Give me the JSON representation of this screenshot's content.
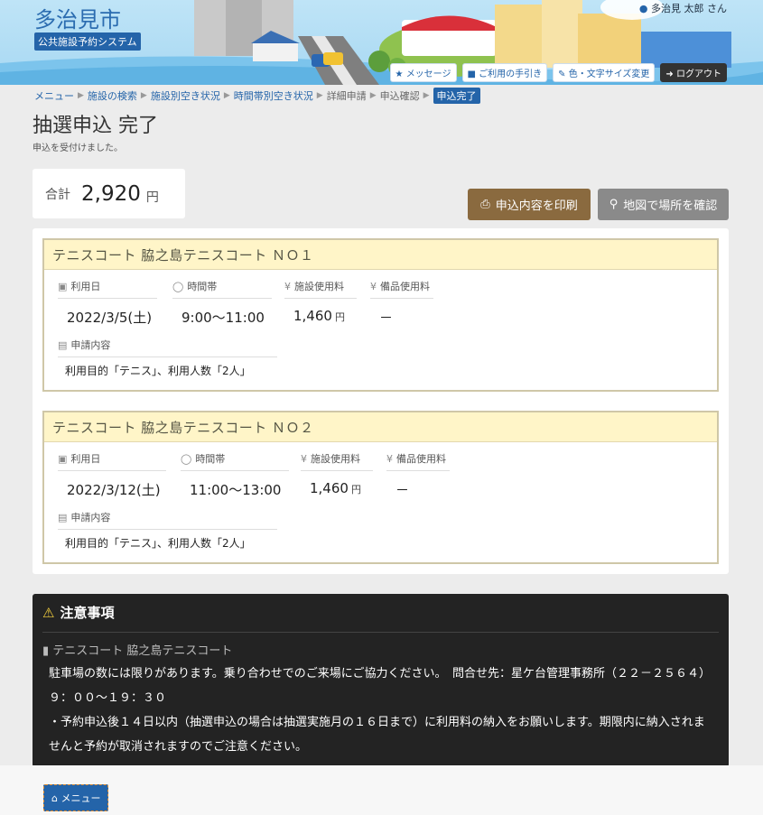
{
  "header": {
    "city": "多治見市",
    "system": "公共施設予約システム",
    "user": "多治見 太郎 さん",
    "buttons": {
      "message": "メッセージ",
      "guide": "ご利用の手引き",
      "display": "色・文字サイズ変更",
      "logout": "ログアウト"
    }
  },
  "breadcrumb": {
    "menu": "メニュー",
    "search": "施設の検索",
    "facility_vacancy": "施設別空き状況",
    "time_vacancy": "時間帯別空き状況",
    "detail": "詳細申請",
    "confirm": "申込確認",
    "current": "申込完了"
  },
  "page": {
    "title": "抽選申込 完了",
    "note": "申込を受付けました。"
  },
  "total": {
    "label": "合計",
    "value": "2,920",
    "unit": "円"
  },
  "actions": {
    "print": "申込内容を印刷",
    "map": "地図で場所を確認"
  },
  "labels": {
    "date": "利用日",
    "time": "時間帯",
    "facility_fee": "施設使用料",
    "equipment_fee": "備品使用料",
    "content": "申請内容",
    "yen": "円"
  },
  "reservations": [
    {
      "title": "テニスコート 脇之島テニスコート ＮＯ１",
      "date": "2022/3/5(土)",
      "time": "9:00～11:00",
      "facility_fee": "1,460",
      "equipment_fee": "－",
      "content": "利用目的「テニス」、利用人数「2人」"
    },
    {
      "title": "テニスコート 脇之島テニスコート ＮＯ２",
      "date": "2022/3/12(土)",
      "time": "11:00～13:00",
      "facility_fee": "1,460",
      "equipment_fee": "－",
      "content": "利用目的「テニス」、利用人数「2人」"
    }
  ],
  "notice": {
    "title": "注意事項",
    "facility": "テニスコート 脇之島テニスコート",
    "line1": "駐車場の数には限りがあります。乗り合わせでのご来場にご協力ください。　問合せ先：星ケ台管理事務所（２２－２５６４）　９：００～１９：３０",
    "line2": "・予約申込後１４日以内（抽選申込の場合は抽選実施月の１６日まで）に利用料の納入をお願いします。期限内に納入されませんと予約が取消されますのでご注意ください。"
  },
  "footer": {
    "menu": "メニュー"
  },
  "colors": {
    "primary": "#2464a9",
    "print_button": "#8a6a3f",
    "map_button": "#8a8a8a",
    "card_header": "#fff5c8",
    "notice_bg": "#232323"
  }
}
